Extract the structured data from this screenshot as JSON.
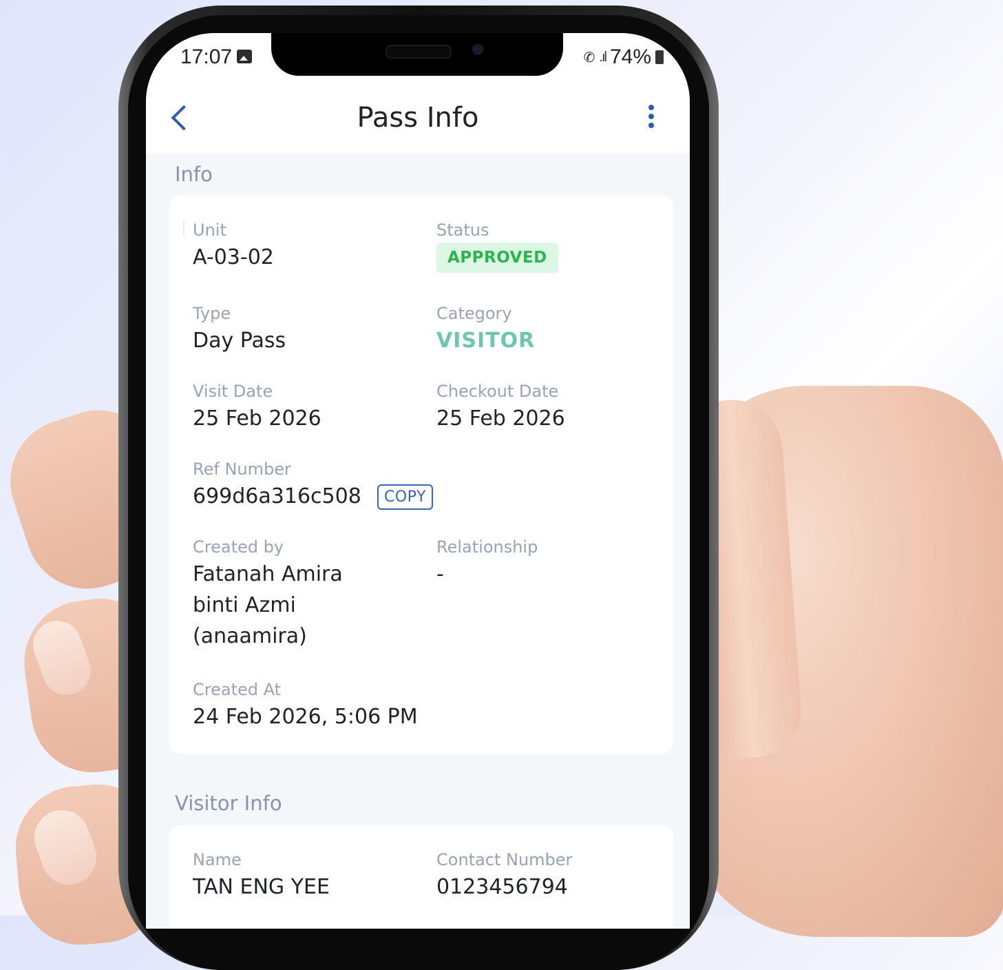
{
  "statusbar": {
    "time": "17:07",
    "battery": "74%"
  },
  "header": {
    "title": "Pass Info"
  },
  "info": {
    "section_label": "Info",
    "unit_label": "Unit",
    "unit_value": "A-03-02",
    "status_label": "Status",
    "status_value": "APPROVED",
    "type_label": "Type",
    "type_value": "Day Pass",
    "category_label": "Category",
    "category_value": "VISITOR",
    "visit_date_label": "Visit Date",
    "visit_date_value": "25 Feb 2026",
    "checkout_date_label": "Checkout Date",
    "checkout_date_value": "25 Feb 2026",
    "ref_label": "Ref Number",
    "ref_value": "699d6a316c508",
    "copy_label": "COPY",
    "created_by_label": "Created by",
    "created_by_line1": "Fatanah Amira",
    "created_by_line2": "binti Azmi",
    "created_by_line3": "(anaamira)",
    "relationship_label": "Relationship",
    "relationship_value": "-",
    "created_at_label": "Created At",
    "created_at_value": "24 Feb 2026, 5:06 PM"
  },
  "visitor": {
    "section_label": "Visitor Info",
    "name_label": "Name",
    "name_value": "TAN ENG YEE",
    "contact_label": "Contact Number",
    "contact_value": "0123456794"
  },
  "colors": {
    "accent": "#2d5bb3",
    "approved_bg": "#dcf7e4",
    "approved_text": "#2cb44f",
    "visitor_text": "#6fc6b0"
  },
  "icons": [
    "back-arrow-icon",
    "more-vertical-icon",
    "gallery-icon",
    "wifi-call-icon",
    "signal-icon",
    "battery-icon"
  ]
}
